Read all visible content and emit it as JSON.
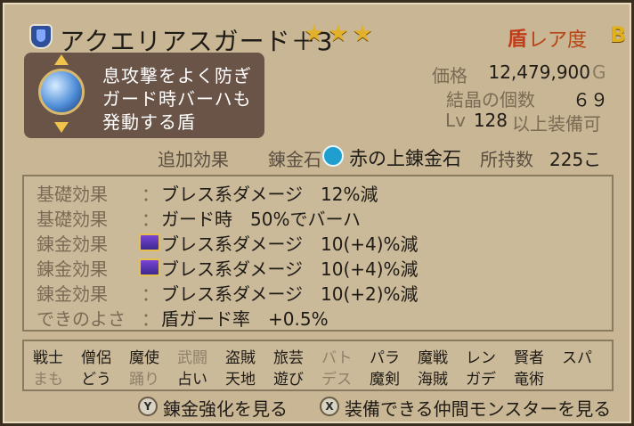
{
  "header": {
    "item_name": "アクエリアスガード＋3",
    "stars": "★★★",
    "rarity_icon": "盾",
    "rarity_label": "レア度",
    "rarity_value": "B"
  },
  "description": {
    "lines": [
      "息攻撃をよく防ぎ",
      "ガード時バーハも",
      "発動する盾"
    ]
  },
  "stats": {
    "price_label": "価格",
    "price_value": "12,479,900",
    "price_unit": "G",
    "crystals_label": "結晶の個数",
    "crystals_value": "６９",
    "level_prefix": "Lv",
    "level_value": "128",
    "level_suffix": "以上装備可"
  },
  "alchemy": {
    "extra_effects_label": "追加効果",
    "stone_label": "錬金石",
    "stone_name": "赤の上錬金石",
    "owned_label": "所持数",
    "owned_value": "225こ"
  },
  "effects": [
    {
      "label": "基礎効果",
      "colon": "：",
      "text": "ブレス系ダメージ　12%減",
      "crown": false
    },
    {
      "label": "基礎効果",
      "colon": "：",
      "text": "ガード時　50%でバーハ",
      "crown": false
    },
    {
      "label": "錬金効果",
      "colon": "",
      "text": "ブレス系ダメージ　10(+4)%減",
      "crown": true
    },
    {
      "label": "錬金効果",
      "colon": "",
      "text": "ブレス系ダメージ　10(+4)%減",
      "crown": true
    },
    {
      "label": "錬金効果",
      "colon": "：",
      "text": "ブレス系ダメージ　10(+2)%減",
      "crown": false
    },
    {
      "label": "できのよさ",
      "colon": "：",
      "text": "盾ガード率　+0.5%",
      "crown": false
    }
  ],
  "jobs": {
    "row1": [
      "戦士",
      "僧侶",
      "魔使",
      "武闘",
      "盗賊",
      "旅芸",
      "バト",
      "パラ",
      "魔戦",
      "レン",
      "賢者",
      "スパ"
    ],
    "row2": [
      "まも",
      "どう",
      "踊り",
      "占い",
      "天地",
      "遊び",
      "デス",
      "魔剣",
      "海賊",
      "ガデ",
      "竜術"
    ]
  },
  "actions": {
    "y_button": "Y",
    "y_label": "錬金強化を見る",
    "x_button": "X",
    "x_label": "装備できる仲間モンスターを見る"
  },
  "colors": {
    "frame": "#c8b694",
    "desc_bg": "#6a5448",
    "rarity": "#e0b01e",
    "stars": "#e2b02a"
  }
}
